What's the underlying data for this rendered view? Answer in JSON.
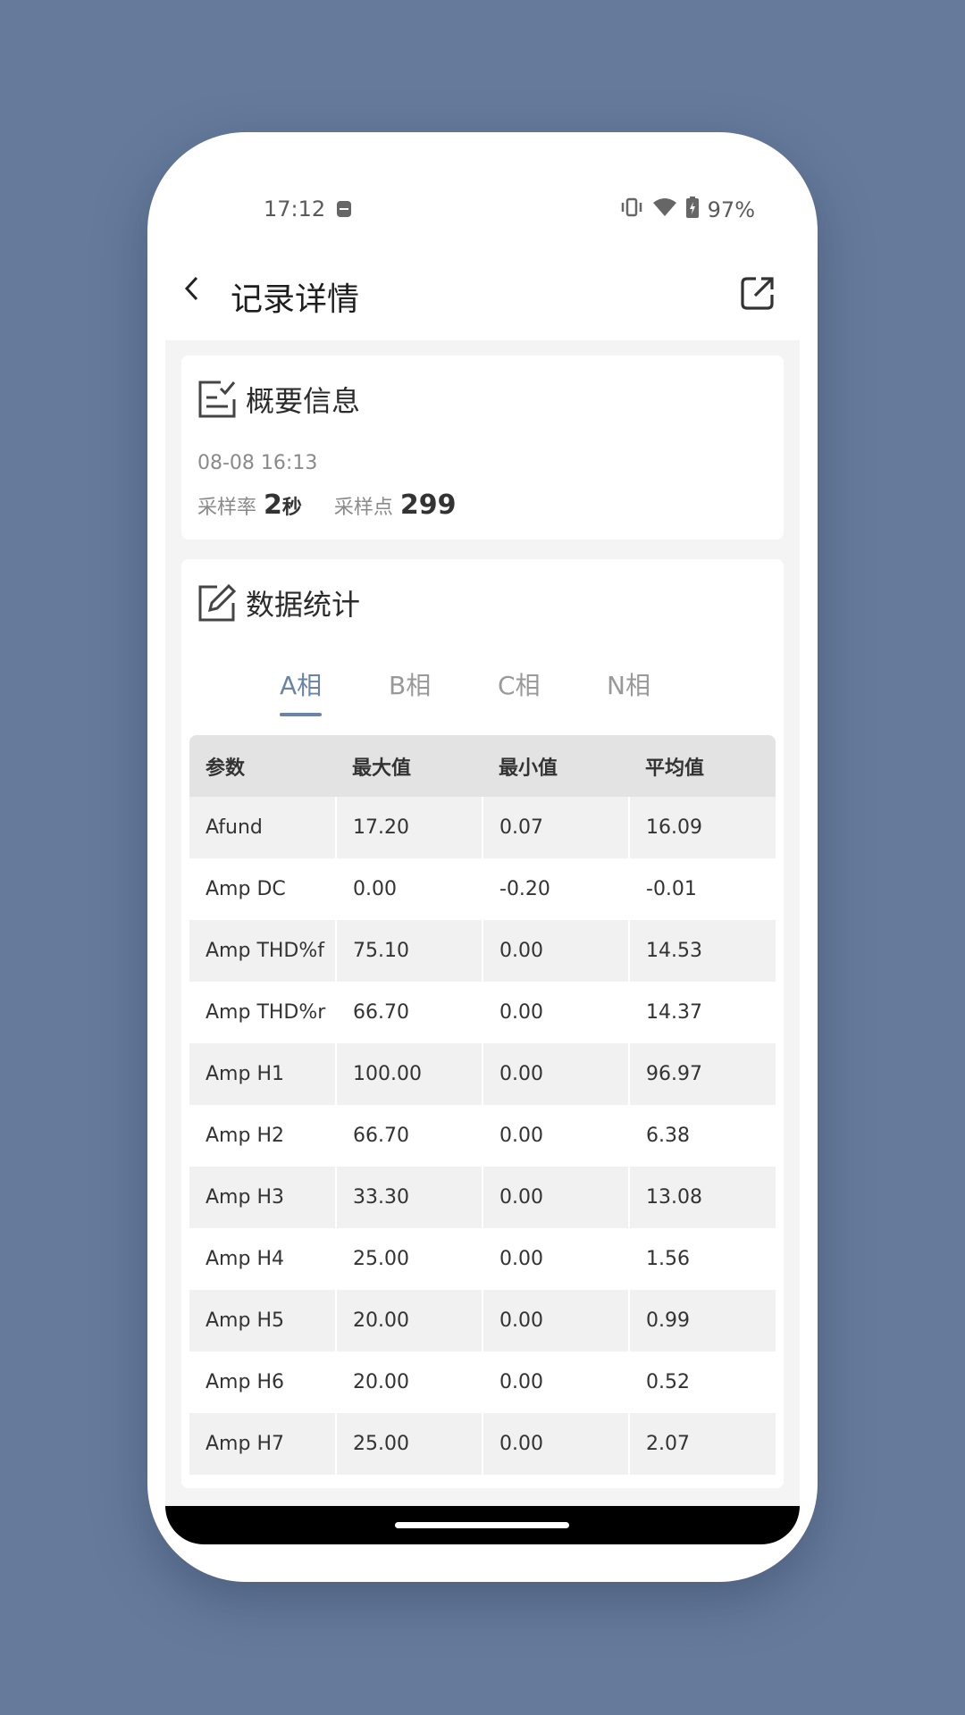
{
  "status_bar": {
    "time": "17:12",
    "battery": "97%"
  },
  "app_bar": {
    "title": "记录详情"
  },
  "summary": {
    "title": "概要信息",
    "date": "08-08 16:13",
    "sample_rate_label": "采样率",
    "sample_rate_value": "2",
    "sample_rate_unit": "秒",
    "sample_points_label": "采样点",
    "sample_points_value": "299"
  },
  "stats": {
    "title": "数据统计",
    "tabs": [
      "A相",
      "B相",
      "C相",
      "N相"
    ],
    "active_tab": "A相",
    "headers": [
      "参数",
      "最大值",
      "最小值",
      "平均值"
    ],
    "rows": [
      [
        "Afund",
        "17.20",
        "0.07",
        "16.09"
      ],
      [
        "Amp DC",
        "0.00",
        "-0.20",
        "-0.01"
      ],
      [
        "Amp THD%f",
        "75.10",
        "0.00",
        "14.53"
      ],
      [
        "Amp THD%r",
        "66.70",
        "0.00",
        "14.37"
      ],
      [
        "Amp H1",
        "100.00",
        "0.00",
        "96.97"
      ],
      [
        "Amp H2",
        "66.70",
        "0.00",
        "6.38"
      ],
      [
        "Amp H3",
        "33.30",
        "0.00",
        "13.08"
      ],
      [
        "Amp H4",
        "25.00",
        "0.00",
        "1.56"
      ],
      [
        "Amp H5",
        "20.00",
        "0.00",
        "0.99"
      ],
      [
        "Amp H6",
        "20.00",
        "0.00",
        "0.52"
      ],
      [
        "Amp H7",
        "25.00",
        "0.00",
        "2.07"
      ]
    ]
  },
  "colors": {
    "background": "#667b9c",
    "accent": "#6a84a6"
  },
  "icons": {
    "back": "back-arrow-icon",
    "share": "share-external-icon",
    "summary": "checklist-icon",
    "stats": "edit-note-icon"
  }
}
